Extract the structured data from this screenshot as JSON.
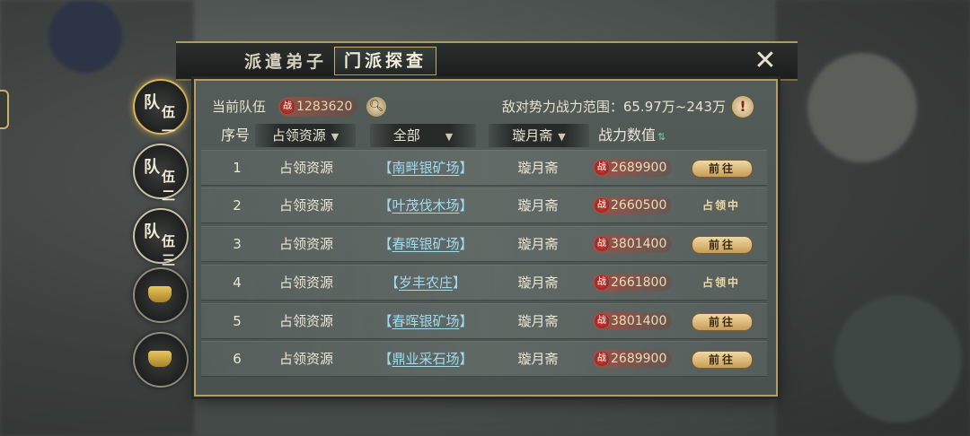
{
  "tabs": {
    "dispatch": "派遣弟子",
    "scout": "门派探查"
  },
  "teams": [
    {
      "line1": "队",
      "line2": "伍一",
      "state": "active"
    },
    {
      "line1": "队",
      "line2": "伍二",
      "state": "normal"
    },
    {
      "line1": "队",
      "line2": "伍三",
      "state": "normal"
    },
    {
      "state": "locked"
    },
    {
      "state": "locked"
    }
  ],
  "header": {
    "current_team_label": "当前队伍",
    "current_power_icon": "战",
    "current_power": "1283620",
    "enemy_range": "敌对势力战力范围：65.97万~243万",
    "warn_glyph": "!"
  },
  "columns": {
    "index": "序号",
    "type_filter": "占领资源",
    "target_filter": "全部",
    "sect_filter": "璇月斋",
    "power": "战力数值"
  },
  "rows": [
    {
      "index": "1",
      "type": "占领资源",
      "target": "南畔银矿场",
      "sect": "璇月斋",
      "power": "2689900",
      "action": "前往",
      "action_type": "button"
    },
    {
      "index": "2",
      "type": "占领资源",
      "target": "叶茂伐木场",
      "sect": "璇月斋",
      "power": "2660500",
      "action": "占领中",
      "action_type": "status"
    },
    {
      "index": "3",
      "type": "占领资源",
      "target": "春晖银矿场",
      "sect": "璇月斋",
      "power": "3801400",
      "action": "前往",
      "action_type": "button"
    },
    {
      "index": "4",
      "type": "占领资源",
      "target": "岁丰农庄",
      "sect": "璇月斋",
      "power": "2661800",
      "action": "占领中",
      "action_type": "status"
    },
    {
      "index": "5",
      "type": "占领资源",
      "target": "春晖银矿场",
      "sect": "璇月斋",
      "power": "3801400",
      "action": "前往",
      "action_type": "button"
    },
    {
      "index": "6",
      "type": "占领资源",
      "target": "鼎业采石场",
      "sect": "璇月斋",
      "power": "2689900",
      "action": "前往",
      "action_type": "button"
    }
  ],
  "bracket_left": "【",
  "bracket_right": "】",
  "power_glyph": "战",
  "icons": {
    "close": "close-icon",
    "search": "search-icon",
    "warn": "warning-icon",
    "sort": "sort-icon",
    "chevron": "chevron-down-icon",
    "lock": "lock-icon"
  }
}
